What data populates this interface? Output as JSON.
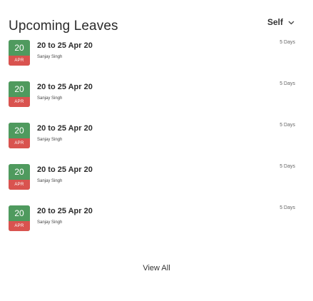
{
  "header": {
    "title": "Upcoming Leaves",
    "filter_label": "Self",
    "filter_icon": "chevron-down-icon"
  },
  "colors": {
    "badge_top": "#4f9a5e",
    "badge_bottom": "#d9534f"
  },
  "leaves": [
    {
      "day": "20",
      "month": "APR",
      "range": "20 to 25 Apr 20",
      "name": "Sanjay Singh",
      "days": "5 Days"
    },
    {
      "day": "20",
      "month": "APR",
      "range": "20 to 25 Apr 20",
      "name": "Sanjay Singh",
      "days": "5 Days"
    },
    {
      "day": "20",
      "month": "APR",
      "range": "20 to 25 Apr 20",
      "name": "Sanjay Singh",
      "days": "5 Days"
    },
    {
      "day": "20",
      "month": "APR",
      "range": "20 to 25 Apr 20",
      "name": "Sanjay Singh",
      "days": "5 Days"
    },
    {
      "day": "20",
      "month": "APR",
      "range": "20 to 25 Apr 20",
      "name": "Sanjay Singh",
      "days": "5 Days"
    }
  ],
  "footer": {
    "view_all_label": "View All"
  }
}
